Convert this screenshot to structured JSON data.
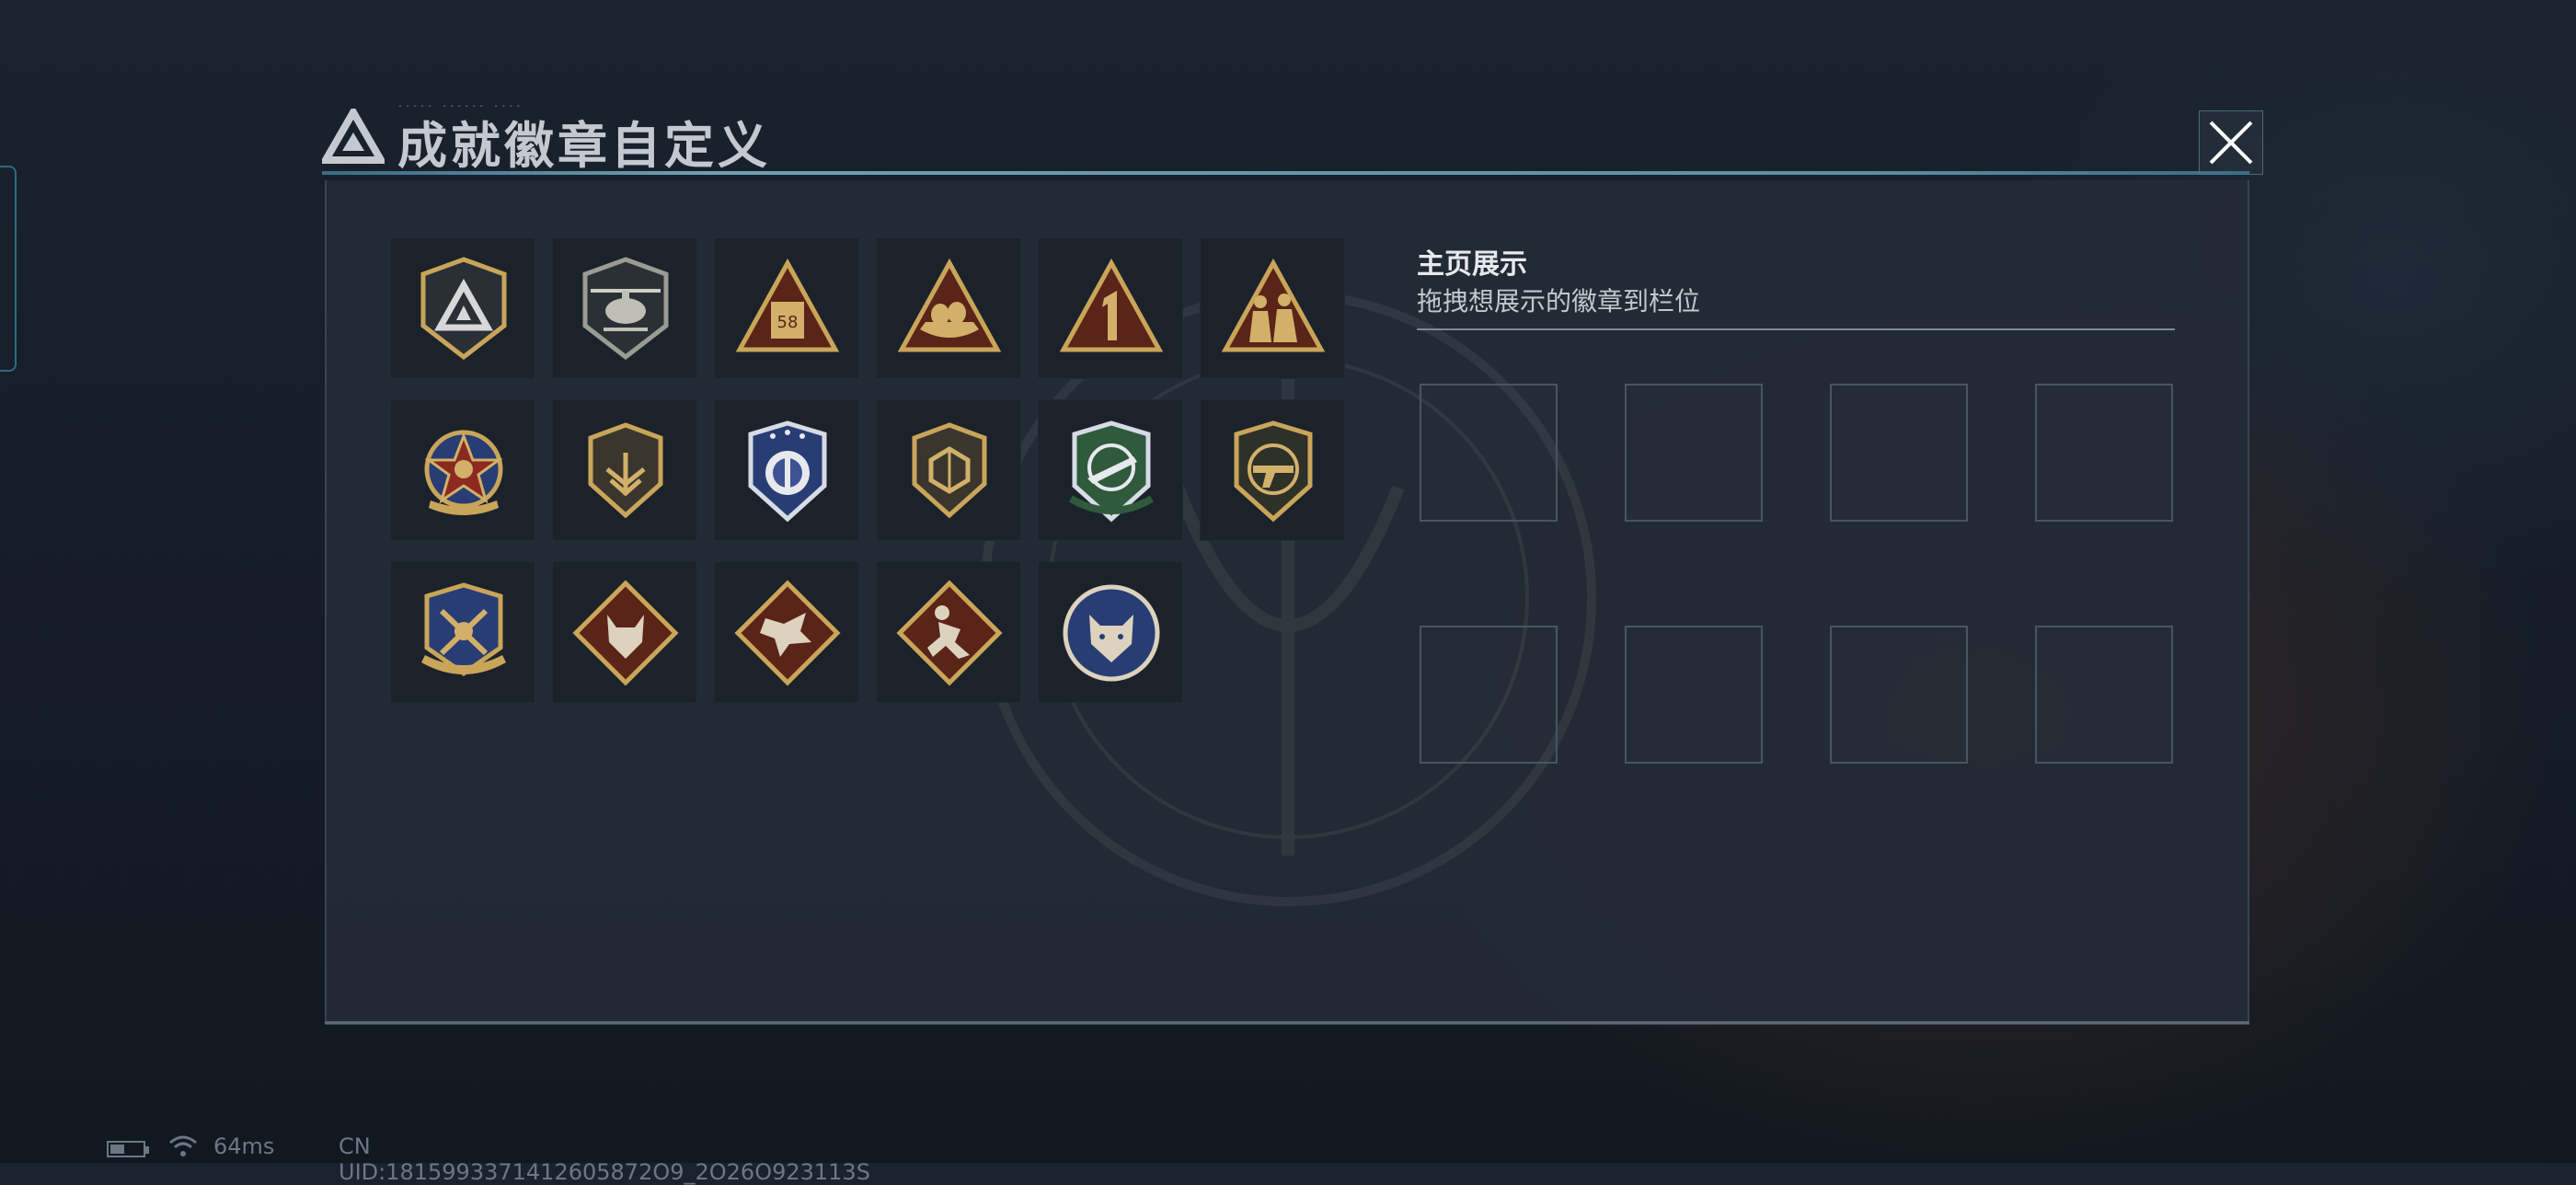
{
  "header": {
    "title": "成就徽章自定义",
    "deco_text": "----- ------ ----"
  },
  "showcase": {
    "title": "主页展示",
    "subtitle": "拖拽想展示的徽章到栏位",
    "slot_count": 8
  },
  "badges": [
    {
      "icon": "shield-triangle-logo-badge-icon"
    },
    {
      "icon": "helicopter-shield-badge-icon"
    },
    {
      "icon": "triangle-58-badge-icon"
    },
    {
      "icon": "triangle-eggs-nest-badge-icon"
    },
    {
      "icon": "triangle-number-one-badge-icon"
    },
    {
      "icon": "triangle-soldiers-badge-icon"
    },
    {
      "icon": "star-emblem-ribbon-badge-icon"
    },
    {
      "icon": "shield-wings-badge-icon"
    },
    {
      "icon": "blue-shield-stars-badge-icon"
    },
    {
      "icon": "shield-hexagon-badge-icon"
    },
    {
      "icon": "green-shield-rifle-badge-icon"
    },
    {
      "icon": "shield-gun-crosshair-badge-icon"
    },
    {
      "icon": "blue-shield-sword-ribbon-badge-icon"
    },
    {
      "icon": "diamond-wolf-badge-icon"
    },
    {
      "icon": "diamond-dragon-badge-icon"
    },
    {
      "icon": "diamond-runner-badge-icon"
    },
    {
      "icon": "circle-wildcat-badge-icon"
    }
  ],
  "status": {
    "ping": "64ms",
    "uid": "CN UID:1815993371412605872O9_2O26O923113S",
    "battery_level": 0.45
  },
  "colors": {
    "gold": "#c9a55a",
    "dark_red": "#5a2418",
    "navy": "#283d73",
    "green": "#2f5a3c",
    "panel": "#242b35",
    "slot_border": "#4b5461"
  }
}
